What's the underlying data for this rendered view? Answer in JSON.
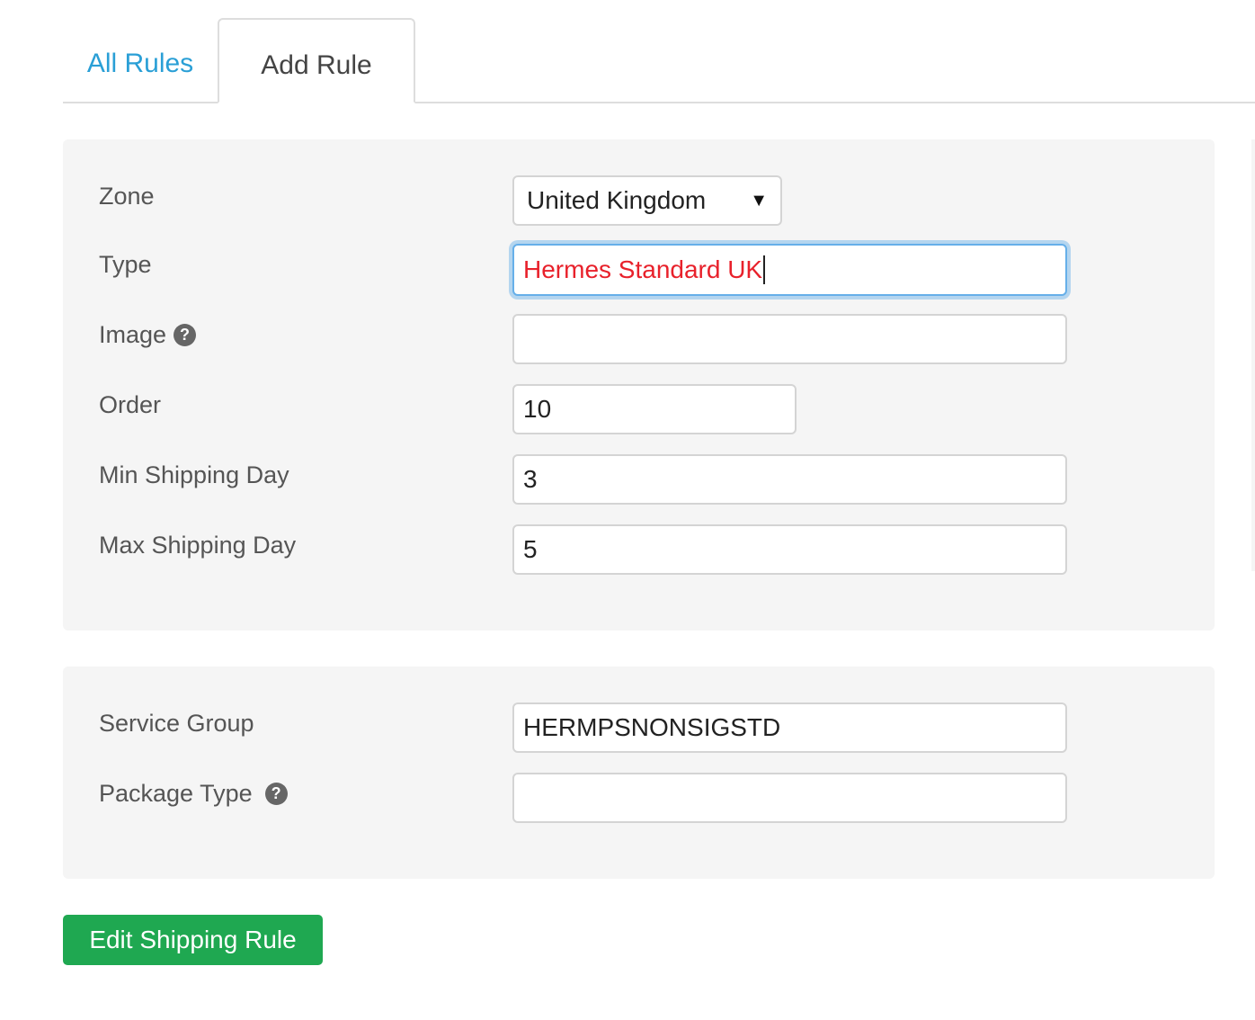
{
  "tabs": {
    "all_rules": "All Rules",
    "add_rule": "Add Rule"
  },
  "form": {
    "zone": {
      "label": "Zone",
      "value": "United Kingdom"
    },
    "type": {
      "label": "Type",
      "value": "Hermes Standard UK"
    },
    "image": {
      "label": "Image",
      "value": ""
    },
    "order": {
      "label": "Order",
      "value": "10"
    },
    "min_shipping_day": {
      "label": "Min Shipping Day",
      "value": "3"
    },
    "max_shipping_day": {
      "label": "Max Shipping Day",
      "value": "5"
    }
  },
  "service": {
    "service_group": {
      "label": "Service Group",
      "value": "HERMPSNONSIGSTD"
    },
    "package_type": {
      "label": "Package Type",
      "value": ""
    }
  },
  "submit_label": "Edit Shipping Rule",
  "icons": {
    "help": "?",
    "dropdown": "▼"
  },
  "colors": {
    "link": "#2a9fd6",
    "focus_text": "#e8212b",
    "submit": "#1fa851"
  }
}
